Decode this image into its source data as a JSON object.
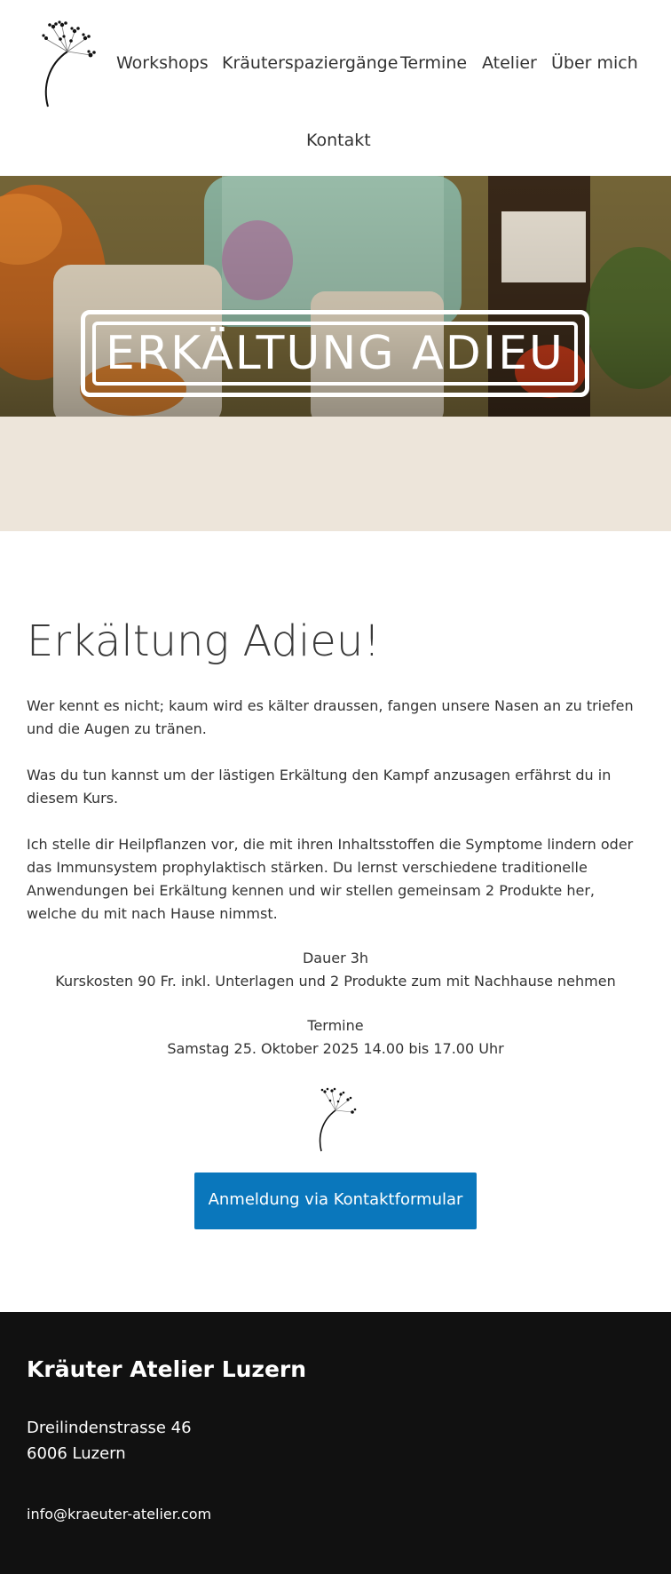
{
  "nav": {
    "items": [
      {
        "label": "Workshops"
      },
      {
        "label": "Kräuterspaziergänge"
      },
      {
        "label": "Termine"
      },
      {
        "label": "Atelier"
      },
      {
        "label": "Über mich"
      },
      {
        "label": "Kontakt"
      }
    ]
  },
  "hero": {
    "title": "ERKÄLTUNG ADIEU"
  },
  "main": {
    "title": "Erkältung Adieu!",
    "paragraphs": [
      "Wer kennt es nicht; kaum wird es kälter draussen, fangen unsere Nasen an zu triefen und die Augen zu tränen.",
      "Was du tun kannst um der lästigen Erkältung den Kampf anzusagen erfährst du in diesem Kurs.",
      "Ich stelle dir Heilpflanzen vor, die mit ihren Inhaltsstoffen die Symptome lindern oder das Immunsystem prophylaktisch stärken. Du lernst verschiedene traditionelle Anwendungen bei Erkältung kennen und wir  stellen gemeinsam 2 Produkte her, welche du mit nach Hause nimmst."
    ],
    "duration": "Dauer 3h",
    "cost": "Kurskosten 90 Fr. inkl. Unterlagen und 2 Produkte zum mit Nachhause nehmen",
    "dates_heading": "Termine",
    "date": "Samstag 25. Oktober 2025 14.00 bis 17.00 Uhr",
    "cta_label": "Anmeldung via Kontaktformular"
  },
  "footer": {
    "title": "Kräuter Atelier Luzern",
    "street": "Dreilindenstrasse 46",
    "city": "6006 Luzern",
    "email": "info@kraeuter-atelier.com"
  },
  "colors": {
    "accent": "#0a77bc",
    "beige": "#ede5da",
    "footer_bg": "#111111"
  }
}
